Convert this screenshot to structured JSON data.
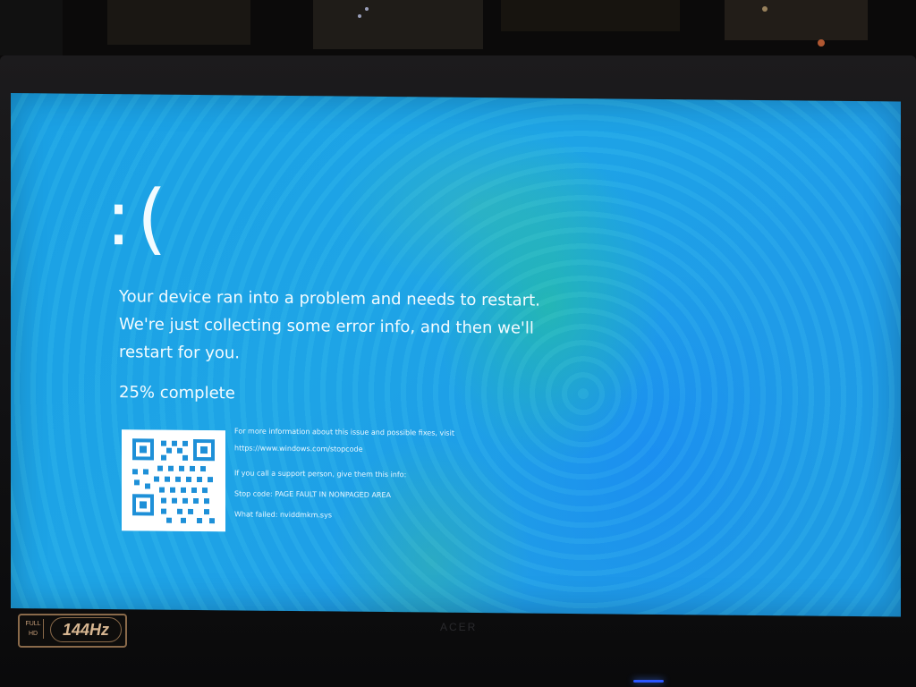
{
  "colors": {
    "bsod_blue": "#1ea4e6",
    "text": "#f3fbff",
    "qr_bg": "#ffffff"
  },
  "screen": {
    "emoticon": ":(",
    "message": "Your device ran into a problem and needs to restart.\nWe're just collecting some error info, and then we'll\nrestart for you.",
    "progress_text": "25% complete",
    "progress_value": 0.25,
    "info": {
      "more_info": "For more information about this issue and possible fixes, visit",
      "url": "https://www.windows.com/stopcode",
      "support": "If you call a support person, give them this info:",
      "stop_code": "Stop code: PAGE FAULT IN NONPAGED AREA",
      "what_failed": "What failed: nviddmkm.sys"
    },
    "qr": {
      "icon": "qr-code-icon"
    }
  },
  "monitor": {
    "badge": {
      "full_hd": "FULL\nHD",
      "refresh": "144Hz"
    },
    "brand": "ACER",
    "power_led": "power-led-icon"
  }
}
